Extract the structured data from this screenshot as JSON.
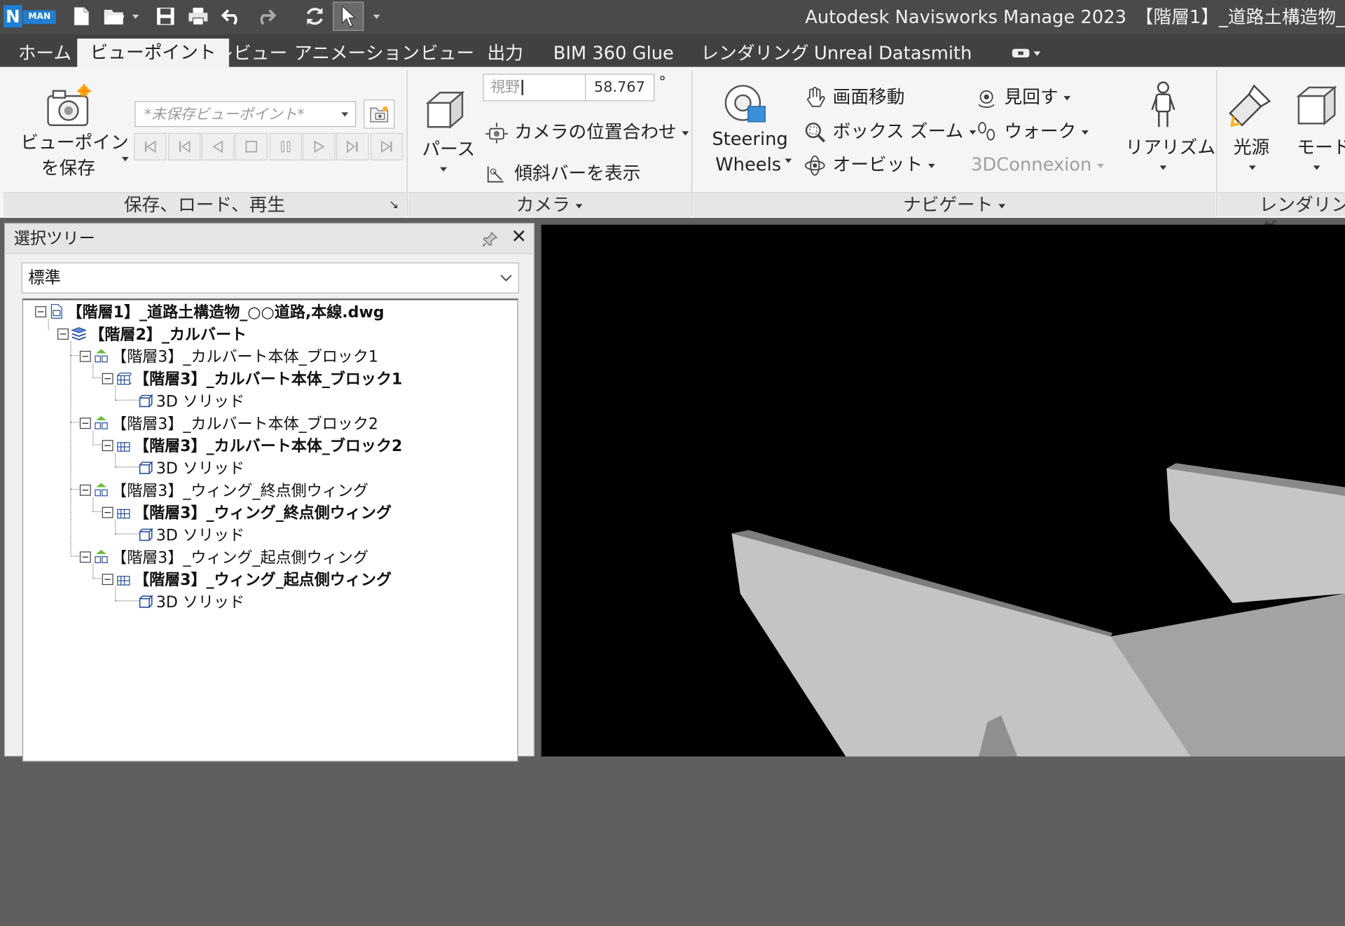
{
  "app": {
    "title": "Autodesk Navisworks Manage 2023　【階層1】_道路土構造物_",
    "logo_letter": "N",
    "logo_badge": "MAN"
  },
  "quick_access": [
    "new-file-icon",
    "open-folder-icon",
    "save-icon",
    "print-icon",
    "undo-icon",
    "redo-icon",
    "refresh-icon",
    "select-cursor-icon"
  ],
  "tabs": [
    {
      "label": "ホーム",
      "active": false
    },
    {
      "label": "ビューポイント",
      "active": true
    },
    {
      "label": "レビュー",
      "active": false
    },
    {
      "label": "アニメーション",
      "active": false
    },
    {
      "label": "ビュー",
      "active": false
    },
    {
      "label": "出力",
      "active": false
    },
    {
      "label": "BIM 360 Glue",
      "active": false
    },
    {
      "label": "レンダリング",
      "active": false
    },
    {
      "label": "Unreal Datasmith",
      "active": false
    }
  ],
  "ribbon": {
    "save_panel": {
      "save_viewpoint_line1": "ビューポイント",
      "save_viewpoint_line2": "を保存",
      "viewpoint_dropdown": "*未保存ビューポイント*",
      "footer": "保存、ロード、再生"
    },
    "camera_panel": {
      "perspective": "パース",
      "fov_label": "視野",
      "fov_value": "58.767",
      "fov_unit": "°",
      "align_camera": "カメラの位置合わせ",
      "show_tilt_bar": "傾斜バーを表示",
      "footer": "カメラ"
    },
    "navigate_panel": {
      "steering_line1": "Steering",
      "steering_line2": "Wheels",
      "pan": "画面移動",
      "box_zoom": "ボックス ズーム",
      "orbit": "オービット",
      "look_around": "見回す",
      "walk": "ウォーク",
      "connexion": "3DConnexion",
      "realism": "リアリズム",
      "footer": "ナビゲート"
    },
    "render_panel": {
      "light": "光源",
      "mode": "モード",
      "footer": "レンダリング"
    }
  },
  "selection_tree": {
    "title": "選択ツリー",
    "filter": "標準",
    "items": [
      {
        "label": "【階層1】_道路土構造物_○○道路,本線.dwg",
        "bold": true
      },
      {
        "label": "【階層2】_カルバート",
        "bold": true
      },
      {
        "label": "【階層3】_カルバート本体_ブロック1",
        "bold": false
      },
      {
        "label": "【階層3】_カルバート本体_ブロック1",
        "bold": true
      },
      {
        "label": "3D ソリッド",
        "bold": false
      },
      {
        "label": "【階層3】_カルバート本体_ブロック2",
        "bold": false
      },
      {
        "label": "【階層3】_カルバート本体_ブロック2",
        "bold": true
      },
      {
        "label": "3D ソリッド",
        "bold": false
      },
      {
        "label": "【階層3】_ウィング_終点側ウィング",
        "bold": false
      },
      {
        "label": "【階層3】_ウィング_終点側ウィング",
        "bold": true
      },
      {
        "label": "3D ソリッド",
        "bold": false
      },
      {
        "label": "【階層3】_ウィング_起点側ウィング",
        "bold": false
      },
      {
        "label": "【階層3】_ウィング_起点側ウィング",
        "bold": true
      },
      {
        "label": "3D ソリッド",
        "bold": false
      }
    ]
  },
  "colors": {
    "titlebar": "#4a4a4a",
    "tabbar": "#414141",
    "ribbon": "#f5f5f5",
    "viewport_bg": "#000000",
    "model_light": "#c8c8c8",
    "model_mid": "#a8a8a8",
    "model_dark": "#808080"
  }
}
